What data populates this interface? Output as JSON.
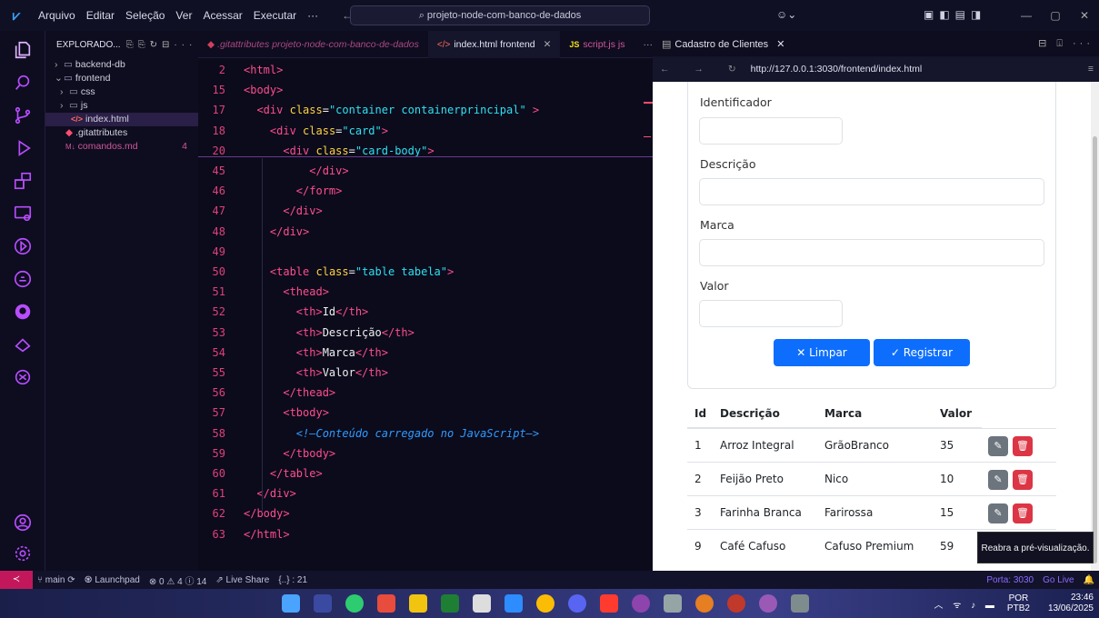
{
  "titlebar": {
    "menu": [
      "Arquivo",
      "Editar",
      "Seleção",
      "Ver",
      "Acessar",
      "Executar",
      "···"
    ],
    "nav_arrows": "← →",
    "search": "⌕ projeto-node-com-banco-de-dados",
    "copilot": "☺⌄",
    "layout_icons": "▣◧▤◨",
    "min": "—",
    "max": "▢",
    "close": "✕"
  },
  "explorer": {
    "header": "EXPLORADO...",
    "tools": "⎘⎘↻⊟···",
    "items": [
      {
        "label": "backend-db",
        "chev": "›",
        "kind": "folder"
      },
      {
        "label": "frontend",
        "chev": "⌄",
        "kind": "folder"
      },
      {
        "label": "css",
        "chev": "›",
        "kind": "folder"
      },
      {
        "label": "js",
        "chev": "›",
        "kind": "folder"
      },
      {
        "label": "index.html",
        "chev": "",
        "kind": "html"
      },
      {
        "label": ".gitattributes",
        "chev": "",
        "kind": "git"
      },
      {
        "label": "comandos.md",
        "chev": "",
        "kind": "md",
        "badge": "4"
      }
    ]
  },
  "editor_tabs": {
    "tab1": ".gitattributes projeto-node-com-banco-de-dados",
    "tab2": "index.html frontend",
    "tab2_close": "✕",
    "tab3": "script.js js",
    "more": "···"
  },
  "code_lines": [
    {
      "n": "2",
      "html": "<html>"
    },
    {
      "n": "15",
      "html": "<body>"
    },
    {
      "n": "17",
      "html": "  <div class=\"container containerprincipal\" >"
    },
    {
      "n": "18",
      "html": "    <div class=\"card\">"
    },
    {
      "n": "20",
      "html": "      <div class=\"card-body\">"
    },
    {
      "n": "45",
      "html": "          </div>"
    },
    {
      "n": "46",
      "html": "        </form>"
    },
    {
      "n": "47",
      "html": "      </div>"
    },
    {
      "n": "48",
      "html": "    </div>"
    },
    {
      "n": "49",
      "html": ""
    },
    {
      "n": "50",
      "html": "    <table class=\"table tabela\">"
    },
    {
      "n": "51",
      "html": "      <thead>"
    },
    {
      "n": "52",
      "html": "        <th>Id</th>"
    },
    {
      "n": "53",
      "html": "        <th>Descrição</th>"
    },
    {
      "n": "54",
      "html": "        <th>Marca</th>"
    },
    {
      "n": "55",
      "html": "        <th>Valor</th>"
    },
    {
      "n": "56",
      "html": "      </thead>"
    },
    {
      "n": "57",
      "html": "      <tbody>"
    },
    {
      "n": "58",
      "html": "        <!—Conteúdo carregado no JavaScript—>"
    },
    {
      "n": "59",
      "html": "      </tbody>"
    },
    {
      "n": "60",
      "html": "    </table>"
    },
    {
      "n": "61",
      "html": "  </div>"
    },
    {
      "n": "62",
      "html": "</body>"
    },
    {
      "n": "63",
      "html": "</html>"
    }
  ],
  "browser": {
    "tab_title": "Cadastro de Clientes",
    "tab_close": "✕",
    "tab_actions": "⊟ ⍗ ···",
    "nav": "← → ↻",
    "url": "http://127.0.0.1:3030/frontend/index.html",
    "menu": "≡"
  },
  "form": {
    "label_id": "Identificador",
    "label_desc": "Descrição",
    "label_marca": "Marca",
    "label_valor": "Valor",
    "btn_limpar": "✕ Limpar",
    "btn_registrar": "✓ Registrar"
  },
  "table": {
    "headers": [
      "Id",
      "Descrição",
      "Marca",
      "Valor"
    ],
    "rows": [
      {
        "id": "1",
        "desc": "Arroz Integral",
        "marca": "GrãoBranco",
        "valor": "35"
      },
      {
        "id": "2",
        "desc": "Feijão Preto",
        "marca": "Nico",
        "valor": "10"
      },
      {
        "id": "3",
        "desc": "Farinha Branca",
        "marca": "Farirossa",
        "valor": "15"
      },
      {
        "id": "9",
        "desc": "Café Cafuso",
        "marca": "Cafuso Premium",
        "valor": "59"
      }
    ],
    "edit_icon": "✎",
    "delete_icon": "🗑"
  },
  "tooltip": "Reabra a pré-visualização.",
  "statusbar": {
    "remote": "≺",
    "branch": "⑂ main ⟳",
    "launchpad": "♼ Launchpad",
    "problems": "⊗ 0 ⚠ 4 ⓘ 14",
    "liveshare": "⇗ Live Share",
    "braces": "{..} : 21",
    "port": "Porta: 3030",
    "golive": "Go Live",
    "bell": "🔔"
  },
  "taskbar": {
    "lang_top": "POR",
    "lang_bottom": "PTB2",
    "time": "23:46",
    "date": "13/06/2025",
    "tray_icons": "︿ ᯤ ♪ ▬"
  },
  "colors": {
    "accent": "#b84dff",
    "primary_button": "#0d6efd",
    "delete_button": "#dc3545",
    "edit_button": "#6c757d"
  }
}
